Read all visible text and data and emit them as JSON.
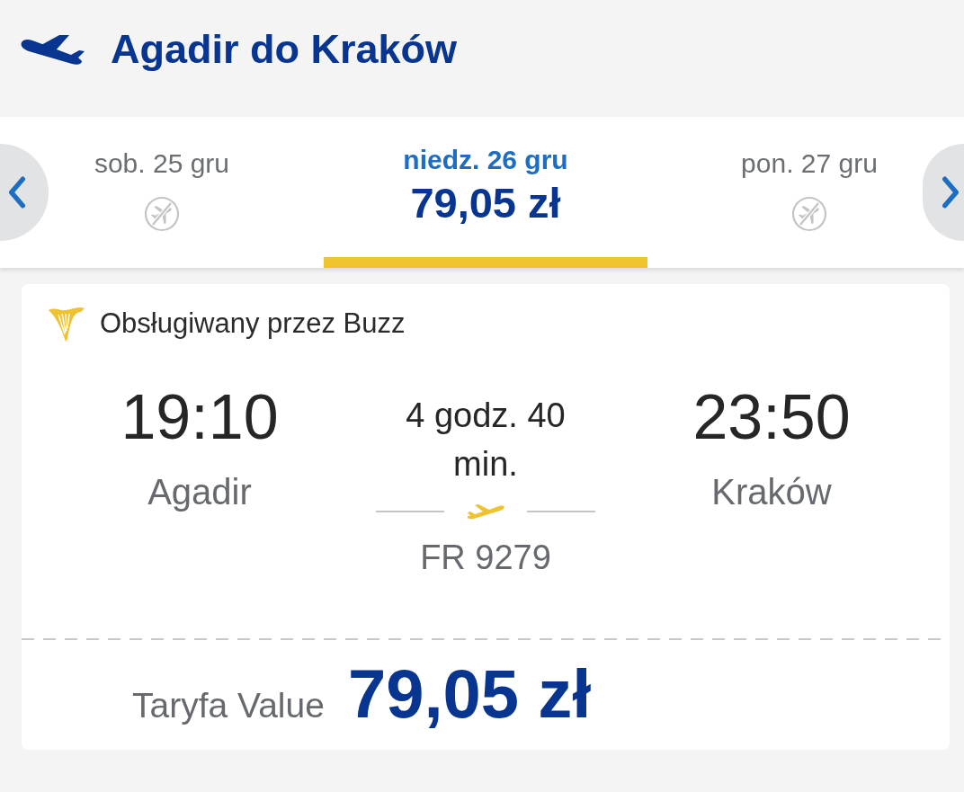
{
  "header": {
    "title": "Agadir do Kraków"
  },
  "date_nav": {
    "dates": [
      {
        "label": "sob. 25 gru",
        "selected": false,
        "available": false
      },
      {
        "label": "niedz. 26 gru",
        "selected": true,
        "available": true,
        "price": "79,05 zł"
      },
      {
        "label": "pon. 27 gru",
        "selected": false,
        "available": false
      }
    ]
  },
  "flight": {
    "operator": "Obsługiwany przez Buzz",
    "departure": {
      "time": "19:10",
      "city": "Agadir"
    },
    "duration": "4 godz. 40 min.",
    "flight_number": "FR 9279",
    "arrival": {
      "time": "23:50",
      "city": "Kraków"
    },
    "fare": {
      "name": "Taryfa Value",
      "price": "79,05 zł"
    }
  }
}
